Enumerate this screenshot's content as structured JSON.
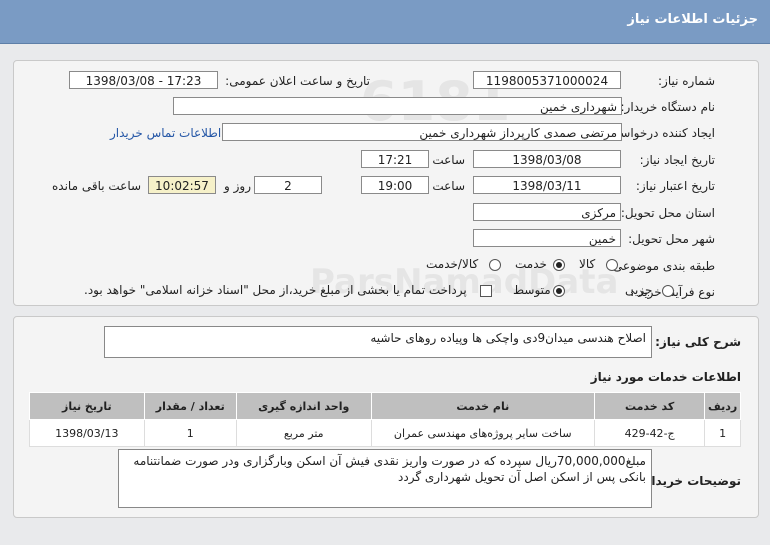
{
  "header": {
    "title": "جزئیات اطلاعات نیاز"
  },
  "form": {
    "need_number_label": "شماره نیاز:",
    "need_number": "1198005371000024",
    "announce_label": "تاریخ و ساعت اعلان عمومی:",
    "announce_value": "1398/03/08 - 17:23",
    "buyer_org_label": "نام دستگاه خریدار:",
    "buyer_org": "شهرداری خمین",
    "requester_label": "ایجاد کننده درخواست:",
    "requester": "مرتضی صمدی کارپرداز شهرداری خمین",
    "contact_link": "اطلاعات تماس خریدار",
    "create_date_label": "تاریخ ایجاد نیاز:",
    "create_date": "1398/03/08",
    "time_label": "ساعت",
    "create_time": "17:21",
    "validity_label": "تاریخ اعتبار نیاز:",
    "validity_date": "1398/03/11",
    "validity_time": "19:00",
    "days_value": "2",
    "days_label": "روز و",
    "remaining_time": "10:02:57",
    "remaining_label": "ساعت باقی مانده",
    "province_label": "استان محل تحویل:",
    "province": "مرکزی",
    "city_label": "شهر محل تحویل:",
    "city": "خمین",
    "category_label": "طبقه بندی موضوعی:",
    "category_options": [
      "کالا",
      "خدمت",
      "کالا/خدمت"
    ],
    "process_label": "نوع فرآیند خرید :",
    "process_options": [
      "جزیی",
      "متوسط"
    ],
    "payment_note": "پرداخت تمام یا بخشی از مبلغ خرید،از محل \"اسناد خزانه اسلامی\" خواهد بود."
  },
  "details": {
    "summary_label": "شرح کلی نیاز:",
    "summary": "اصلاح هندسی میدان9دی واچکی ها وپیاده روهای حاشیه",
    "services_title": "اطلاعات خدمات مورد نیاز",
    "columns": [
      "ردیف",
      "کد خدمت",
      "نام خدمت",
      "واحد اندازه گیری",
      "تعداد / مقدار",
      "تاریخ نیاز"
    ],
    "rows": [
      [
        "1",
        "ج-42-429",
        "ساخت سایر پروژه‌های مهندسی عمران",
        "متر مربع",
        "1",
        "1398/03/13"
      ]
    ],
    "buyer_notes_label": "توضیحات خریدار:",
    "buyer_notes": "مبلغ70,000,000ریال سپرده که در صورت واریز نقدی فیش آن اسکن وبارگزاری ودر صورت ضمانتنامه بانکی پس از اسکن اصل آن تحویل شهرداری گردد"
  },
  "watermark": {
    "brand": "ParsNamadData"
  }
}
